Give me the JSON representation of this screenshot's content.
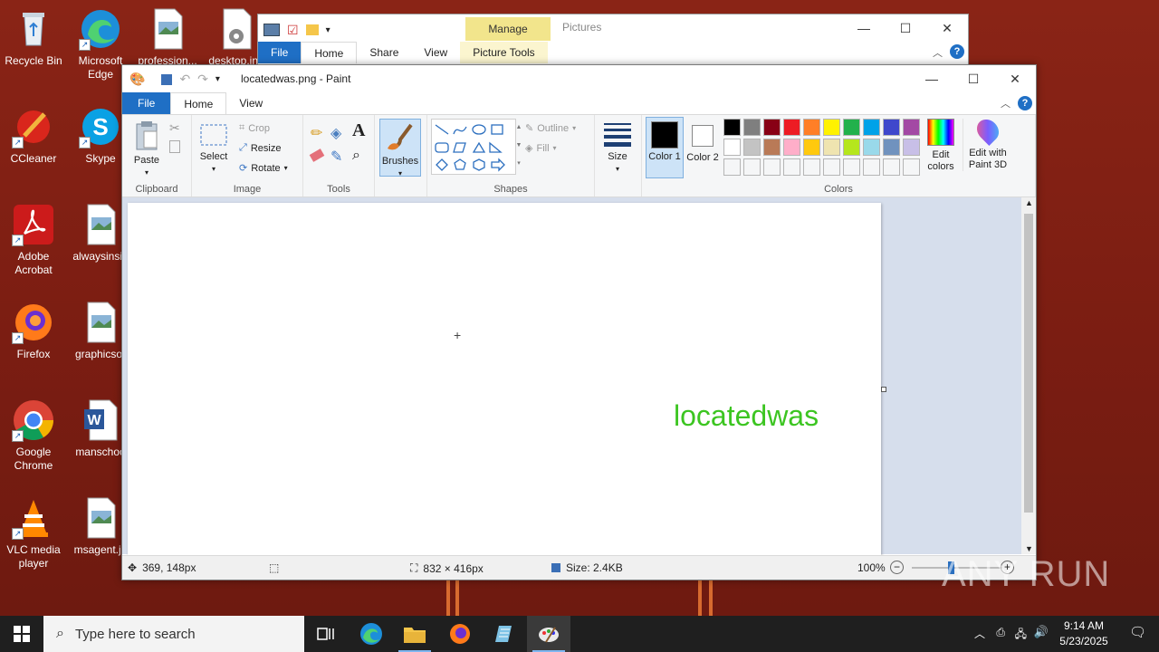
{
  "desktop": {
    "icons": [
      {
        "label": "Recycle Bin"
      },
      {
        "label": "Microsoft Edge"
      },
      {
        "label": "profession..."
      },
      {
        "label": "desktop.ini"
      },
      {
        "label": "CCleaner"
      },
      {
        "label": "Skype"
      },
      {
        "label": "Adobe Acrobat"
      },
      {
        "label": "alwaysinsid"
      },
      {
        "label": "Firefox"
      },
      {
        "label": "graphicsor"
      },
      {
        "label": "Google Chrome"
      },
      {
        "label": "manschoo"
      },
      {
        "label": "VLC media player"
      },
      {
        "label": "msagent.jp"
      }
    ]
  },
  "explorer": {
    "manage_label": "Manage",
    "context_title": "Pictures",
    "tabs": [
      "File",
      "Home",
      "Share",
      "View",
      "Picture Tools"
    ]
  },
  "paint": {
    "title": "locatedwas.png - Paint",
    "tabs": [
      "File",
      "Home",
      "View"
    ],
    "clipboard": {
      "paste": "Paste",
      "group": "Clipboard"
    },
    "image": {
      "select": "Select",
      "crop": "Crop",
      "resize": "Resize",
      "rotate": "Rotate",
      "group": "Image"
    },
    "tools": {
      "group": "Tools"
    },
    "brushes": {
      "label": "Brushes"
    },
    "shapes": {
      "outline": "Outline",
      "fill": "Fill",
      "group": "Shapes"
    },
    "size": {
      "label": "Size"
    },
    "colors": {
      "color1": "Color 1",
      "color2": "Color 2",
      "edit": "Edit colors",
      "paint3d": "Edit with Paint 3D",
      "group": "Colors",
      "palette_row1": [
        "#000000",
        "#7f7f7f",
        "#880015",
        "#ed1c24",
        "#ff7f27",
        "#fff200",
        "#22b14c",
        "#00a2e8",
        "#3f48cc",
        "#a349a4"
      ],
      "palette_row2": [
        "#ffffff",
        "#c3c3c3",
        "#b97a57",
        "#ffaec9",
        "#ffc90e",
        "#efe4b0",
        "#b5e61d",
        "#99d9ea",
        "#7092be",
        "#c8bfe7"
      ]
    },
    "canvas_text": "locatedwas",
    "status": {
      "cursor": "369, 148px",
      "dimensions": "832 × 416px",
      "size": "Size: 2.4KB",
      "zoom": "100%"
    }
  },
  "taskbar": {
    "search_placeholder": "Type here to search",
    "time": "9:14 AM",
    "date": "5/23/2025"
  },
  "watermark": "ANY RUN"
}
